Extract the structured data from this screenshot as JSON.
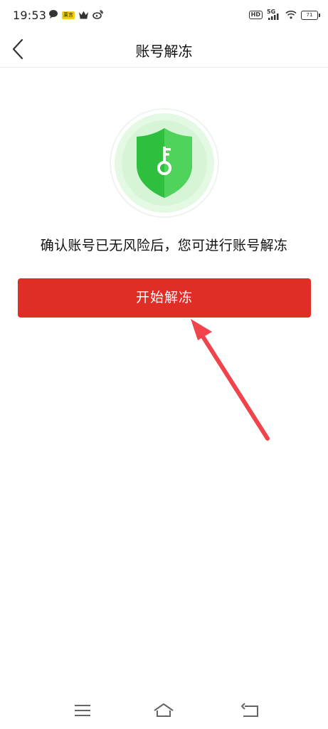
{
  "status_bar": {
    "time": "19:53",
    "left_icons": [
      "chat-bubble-icon",
      "news-badge-icon",
      "crown-icon",
      "weibo-icon"
    ],
    "news_badge_text": "莱言",
    "hd_label": "HD",
    "network_label": "5G",
    "battery_level": "71"
  },
  "nav": {
    "title": "账号解冻",
    "back_icon": "chevron-left-icon"
  },
  "main": {
    "shield_icon": "shield-key-icon",
    "message": "确认账号已无风险后，您可进行账号解冻",
    "button_label": "开始解冻"
  },
  "annotation": {
    "arrow_icon": "red-arrow-icon",
    "color": "#f0434b"
  },
  "bottom_nav": {
    "icons": [
      "menu-icon",
      "home-icon",
      "back-icon"
    ]
  },
  "colors": {
    "primary_red": "#e02e27",
    "shield_green": "#2fbf3f",
    "shield_green_light": "#4fd35a",
    "halo_green": "#e4f9e4"
  }
}
